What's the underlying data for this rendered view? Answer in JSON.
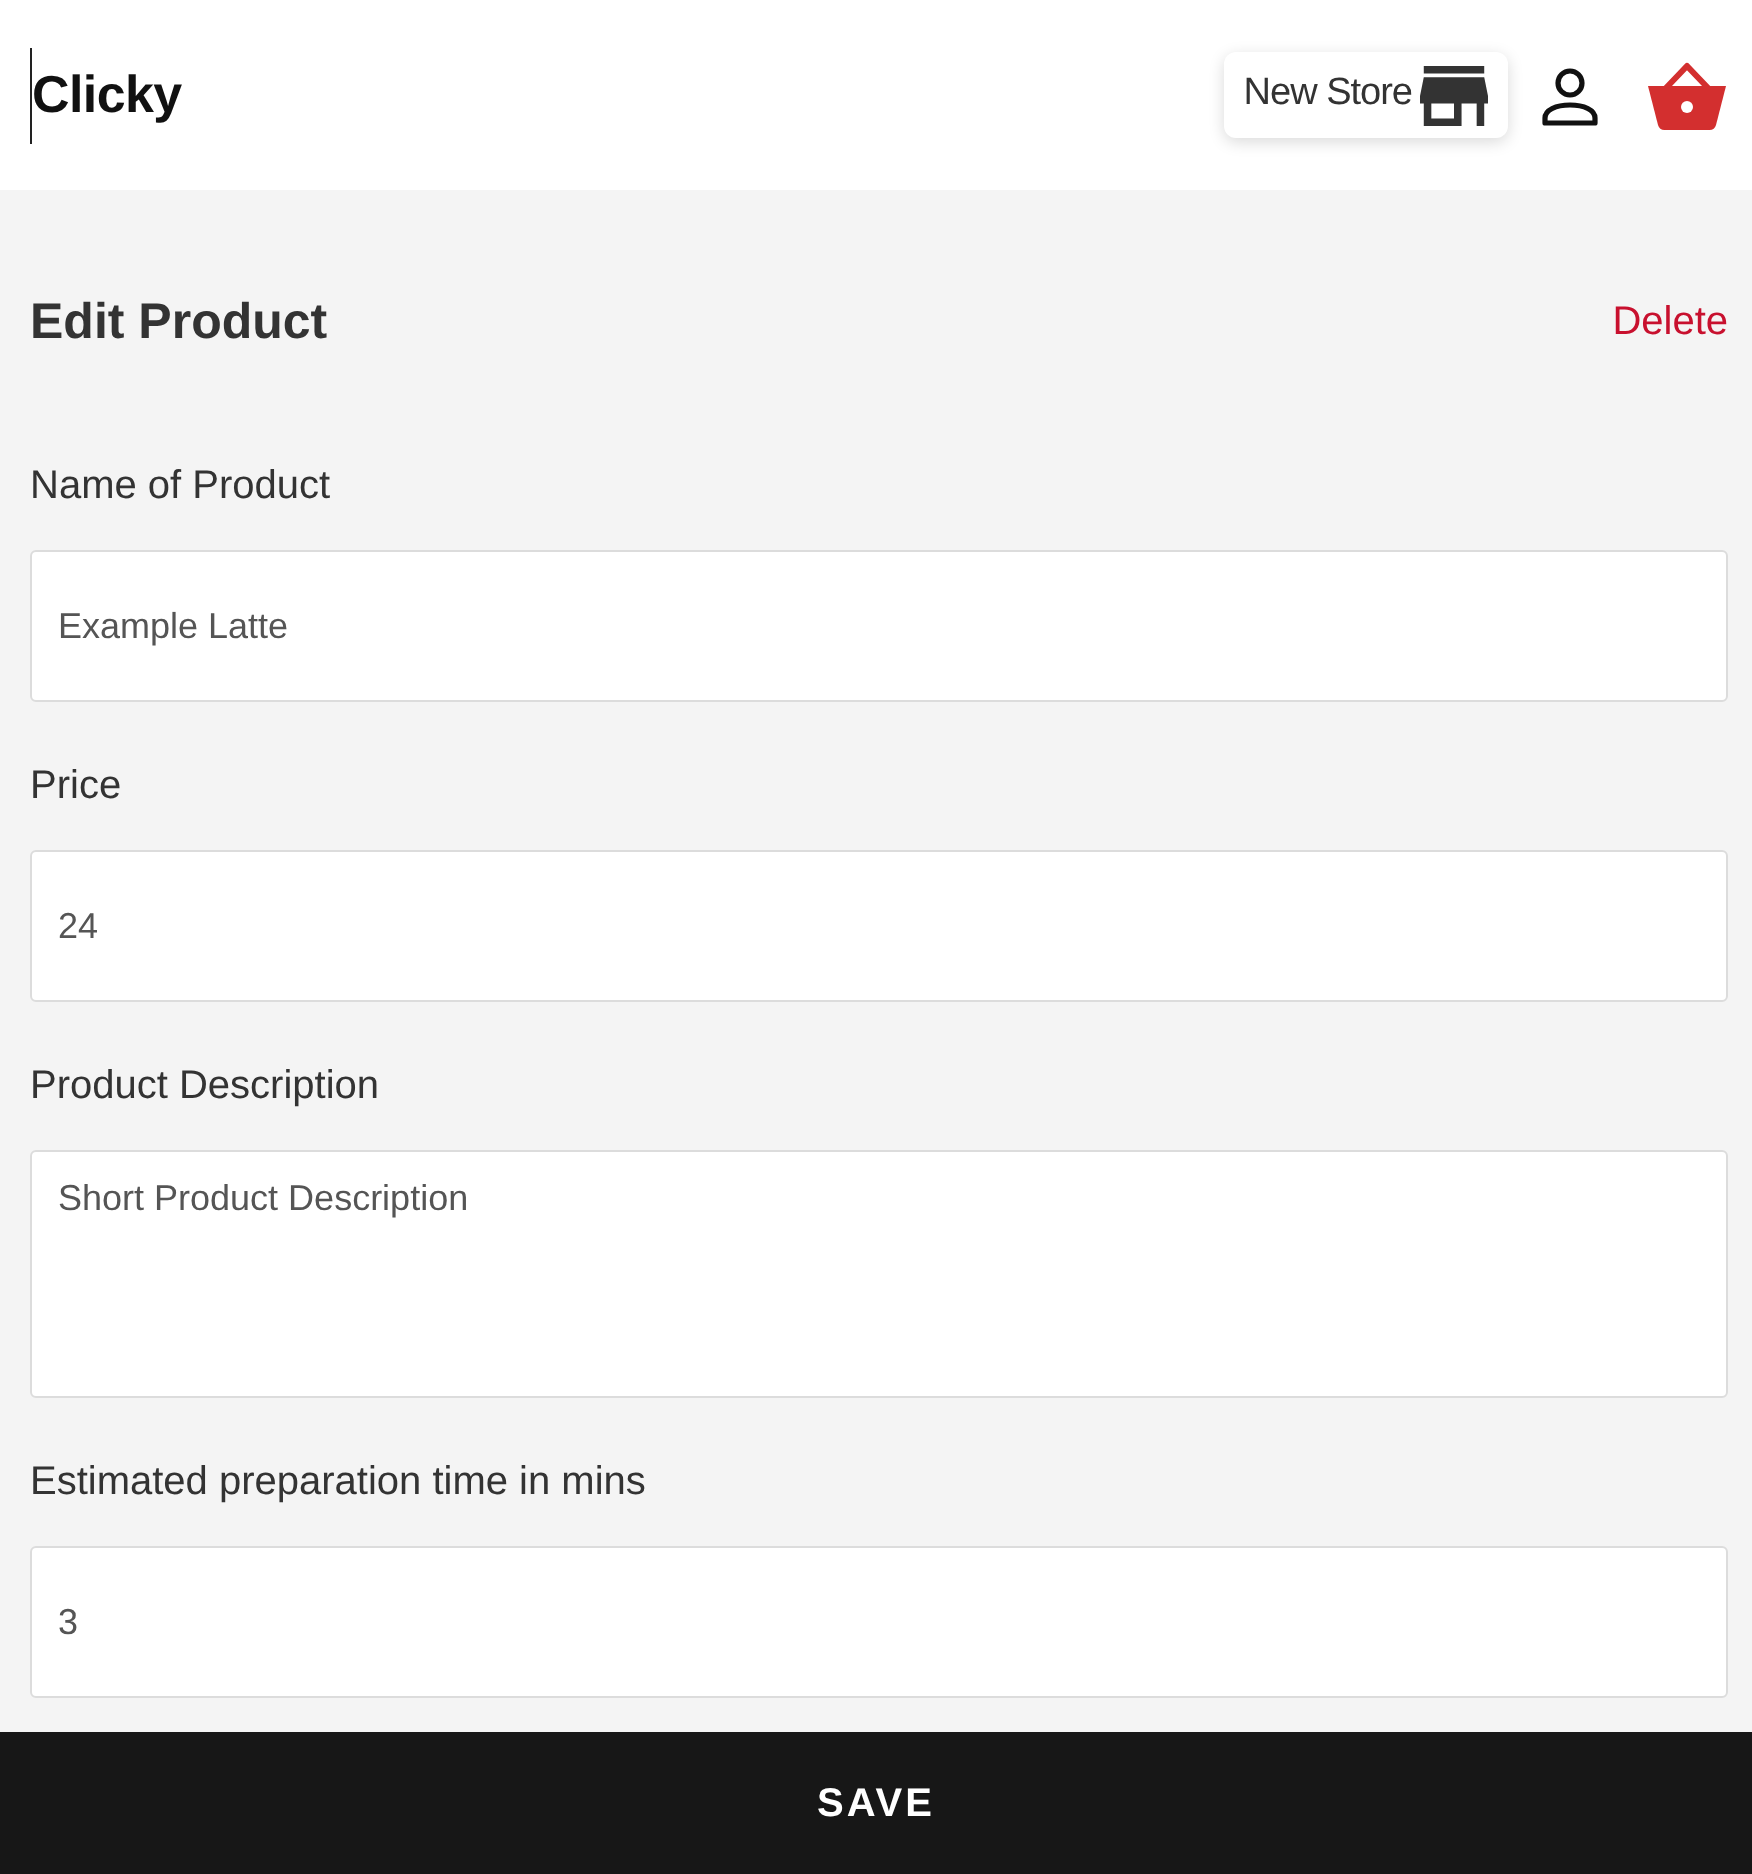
{
  "header": {
    "logo": "Clicky",
    "new_store_button": "New Store"
  },
  "page": {
    "title": "Edit Product",
    "delete_link": "Delete"
  },
  "fields": [
    {
      "label": "Name of Product",
      "kind": "input",
      "value": "Example Latte"
    },
    {
      "label": "Price",
      "kind": "input",
      "value": "24"
    },
    {
      "label": "Product Description",
      "kind": "textarea",
      "value": "Short Product Description"
    },
    {
      "label": "Estimated preparation time in mins",
      "kind": "input",
      "value": "3"
    }
  ],
  "save_button": "SAVE"
}
